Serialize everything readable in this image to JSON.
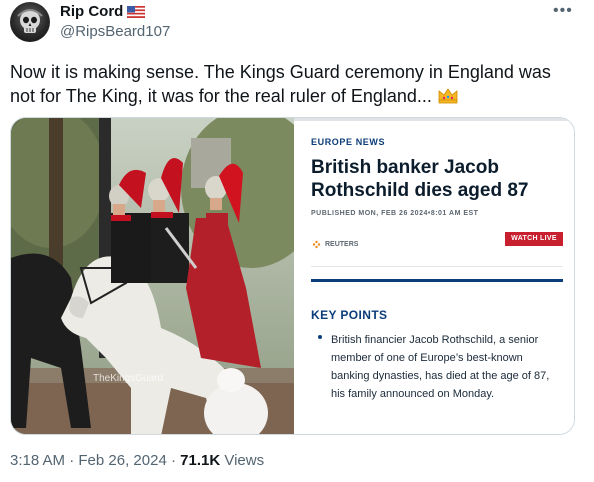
{
  "author": {
    "display_name": "Rip Cord",
    "handle": "@RipsBeard107",
    "flag_icon": "us-flag-icon",
    "avatar_icon": "skull-avatar"
  },
  "menu_icon": "more-options-icon",
  "tweet": {
    "text": "Now it is making sense. The Kings Guard ceremony in England was not for The King, it was for the real ruler of England...",
    "emoji": "crown-icon"
  },
  "media": {
    "video_watermark": "TheKingsGuard",
    "news_card": {
      "section": "EUROPE NEWS",
      "headline": "British banker Jacob Rothschild dies aged 87",
      "published": "PUBLISHED MON, FEB 26 2024•8:01 AM EST",
      "source": "REUTERS",
      "watch_live": "WATCH LIVE",
      "key_points_title": "KEY POINTS",
      "key_point_1": "British financier Jacob Rothschild, a senior member of one of Europe’s best-known banking dynasties, has died at the age of 87, his family announced on Monday."
    }
  },
  "meta": {
    "time": "3:18 AM",
    "date": "Feb 26, 2024",
    "views_count": "71.1K",
    "views_label": "Views"
  },
  "colors": {
    "brand_navy": "#0b3d7a",
    "live_red": "#c8202f",
    "secondary_text": "#536471"
  }
}
